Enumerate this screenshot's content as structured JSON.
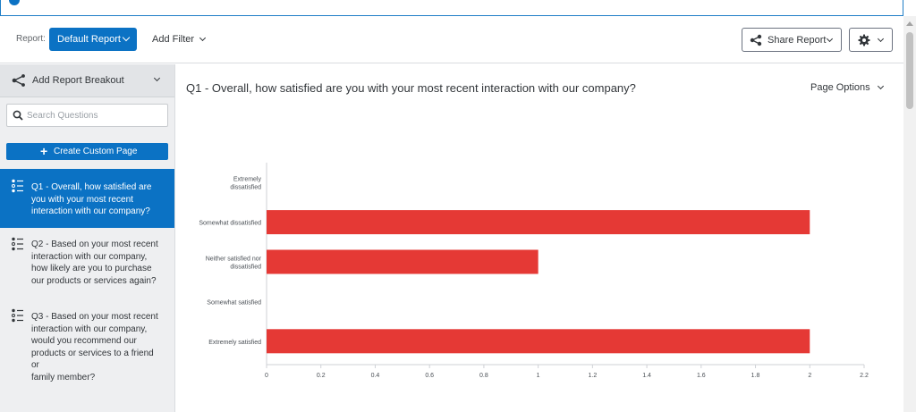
{
  "toolbar": {
    "report_label": "Report:",
    "report_button": "Default Report",
    "add_filter": "Add Filter",
    "share_button": "Share Report"
  },
  "sidebar": {
    "breakout_label": "Add Report Breakout",
    "search_placeholder": "Search Questions",
    "create_button": "Create Custom Page",
    "questions": [
      {
        "label": "Q1 - Overall, how satisfied are you with your most recent interaction with our company?",
        "lines": [
          "Q1 - Overall, how satisfied are",
          "you with your most recent",
          "interaction with our company?"
        ],
        "active": true
      },
      {
        "label": "Q2 - Based on your most recent interaction with our company, how likely are you to purchase our products or services again?",
        "lines": [
          "Q2 - Based on your most recent",
          "interaction with our company,",
          "how likely are you to purchase",
          "our products or services again?"
        ],
        "active": false
      },
      {
        "label": "Q3 - Based on your most recent interaction with our company, would you recommend our products or services to a friend or family member?",
        "lines": [
          "Q3 - Based on your most recent",
          "interaction with our company,",
          "would you recommend our",
          "products or services to a friend or",
          "family member?"
        ],
        "active": false
      }
    ]
  },
  "main": {
    "question_title": "Q1 - Overall, how satisfied are you with your most recent interaction with our company?",
    "page_options": "Page Options"
  },
  "colors": {
    "accent": "#0b72c4",
    "bar": "#e53935"
  },
  "chart_data": {
    "type": "bar",
    "orientation": "horizontal",
    "categories": [
      [
        "Extremely",
        "dissatisfied"
      ],
      [
        "Somewhat dissatisfied"
      ],
      [
        "Neither satisfied nor",
        "dissatisfied"
      ],
      [
        "Somewhat satisfied"
      ],
      [
        "Extremely satisfied"
      ]
    ],
    "values": [
      0,
      2,
      1,
      0,
      2
    ],
    "xlim": [
      0,
      2.2
    ],
    "xticks": [
      "0",
      "0.2",
      "0.4",
      "0.6",
      "0.8",
      "1",
      "1.2",
      "1.4",
      "1.6",
      "1.8",
      "2",
      "2.2"
    ],
    "grid": false
  }
}
